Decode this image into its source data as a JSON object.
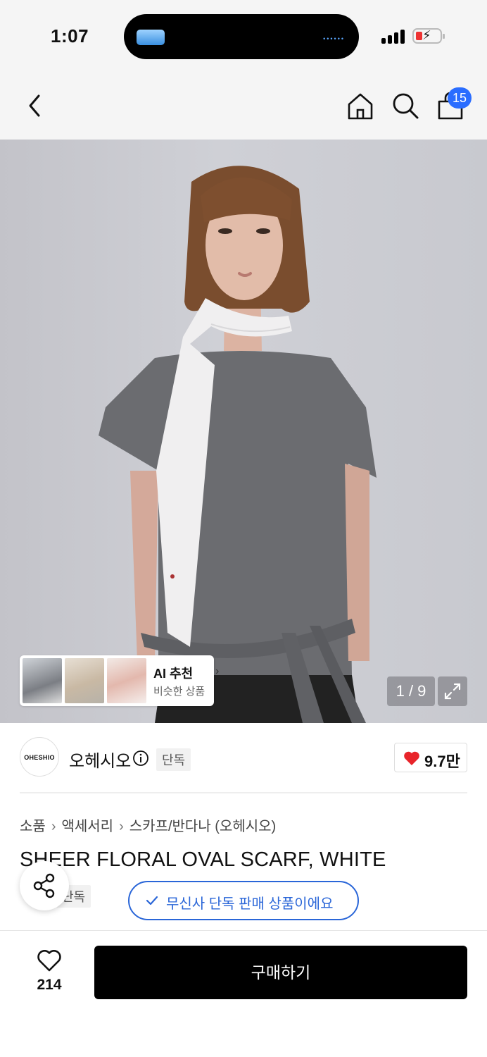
{
  "status_bar": {
    "time": "1:07",
    "battery_color": "#e33333"
  },
  "header": {
    "cart_count": "15",
    "accent": "#2a6dff"
  },
  "gallery": {
    "ai_card": {
      "title": "AI 추천",
      "subtitle": "비슷한 상품"
    },
    "pager": "1 / 9"
  },
  "brand": {
    "logo_text": "OHESHIO",
    "name": "오헤시오",
    "tag": "단독",
    "likes": "9.7만"
  },
  "breadcrumb": [
    "소품",
    "액세서리",
    "스카프/반다나 (오헤시오)"
  ],
  "product": {
    "title": "SHEER FLORAL OVAL SCARF, WHITE",
    "tag": "단독",
    "exclusive_notice": "무신사 단독 판매 상품이에요",
    "notice_color": "#2a66d8"
  },
  "bottom_bar": {
    "wish_count": "214",
    "buy_label": "구매하기"
  },
  "icons": [
    "back-arrow-icon",
    "home-icon",
    "search-icon",
    "cart-icon",
    "expand-icon",
    "info-icon",
    "heart-icon",
    "share-icon",
    "check-icon"
  ]
}
